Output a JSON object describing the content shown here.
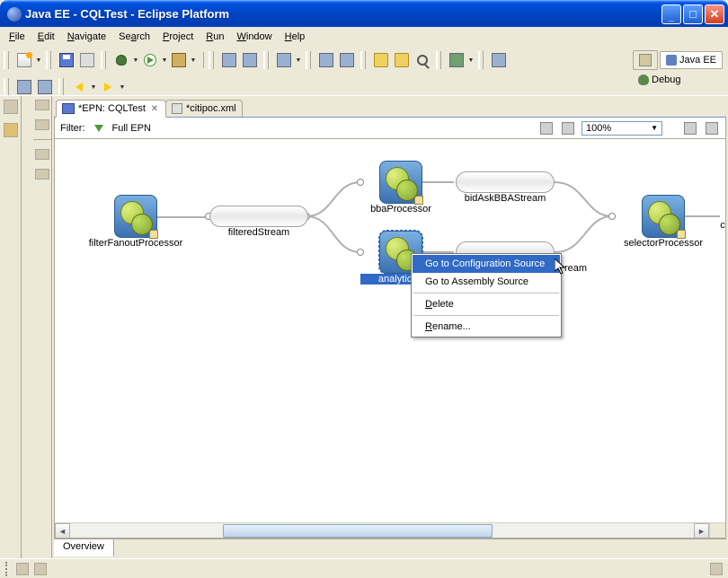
{
  "window": {
    "title": "Java EE - CQLTest - Eclipse Platform"
  },
  "menu": {
    "items": [
      {
        "u": "F",
        "rest": "ile"
      },
      {
        "u": "E",
        "rest": "dit"
      },
      {
        "u": "N",
        "rest": "avigate"
      },
      {
        "u": "",
        "rest": "Se",
        "u2": "a",
        "rest2": "rch"
      },
      {
        "u": "P",
        "rest": "roject"
      },
      {
        "u": "R",
        "rest": "un"
      },
      {
        "u": "W",
        "rest": "indow"
      },
      {
        "u": "H",
        "rest": "elp"
      }
    ],
    "labels": [
      "File",
      "Edit",
      "Navigate",
      "Search",
      "Project",
      "Run",
      "Window",
      "Help"
    ]
  },
  "perspectives": {
    "active": "Java EE",
    "other": "Debug"
  },
  "editor": {
    "tabs": [
      {
        "label": "*EPN: CQLTest",
        "active": true
      },
      {
        "label": "*citipoc.xml",
        "active": false
      }
    ]
  },
  "filterbar": {
    "label": "Filter:",
    "scope": "Full EPN",
    "zoom": "100%"
  },
  "nodes": {
    "filterFanout": "filterFanoutProcessor",
    "filteredStream": "filteredStream",
    "bbaProcessor": "bbaProcessor",
    "analytics": "analyticsP",
    "bidAskStream": "bidAskBBAStream",
    "hiddenStream": "ream",
    "selector": "selectorProcessor",
    "citip": "citip"
  },
  "context_menu": {
    "items": [
      "Go to Configuration Source",
      "Go to Assembly Source",
      "Delete",
      "Rename..."
    ],
    "highlighted": 0,
    "underlines": {
      "2": "D",
      "3": "R"
    }
  },
  "bottom_tab": "Overview"
}
